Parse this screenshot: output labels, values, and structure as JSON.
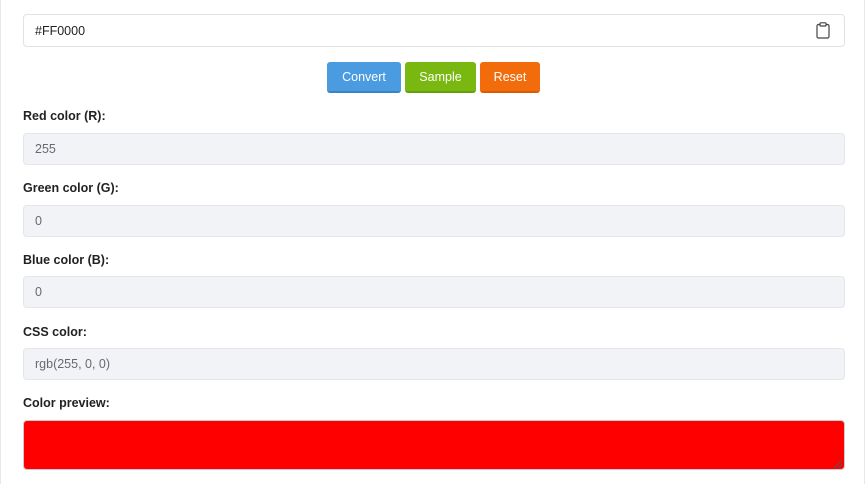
{
  "hex_input": {
    "value": "#FF0000"
  },
  "buttons": {
    "convert": "Convert",
    "sample": "Sample",
    "reset": "Reset"
  },
  "fields": {
    "red": {
      "label": "Red color (R):",
      "value": "255"
    },
    "green": {
      "label": "Green color (G):",
      "value": "0"
    },
    "blue": {
      "label": "Blue color (B):",
      "value": "0"
    },
    "css": {
      "label": "CSS color:",
      "value": "rgb(255, 0, 0)"
    }
  },
  "preview": {
    "label": "Color preview:",
    "color": "#FF0000"
  },
  "icons": {
    "copy": "clipboard-icon"
  },
  "colors": {
    "convert_button": "#4a9be0",
    "sample_button": "#78b811",
    "reset_button": "#f26c0c"
  }
}
